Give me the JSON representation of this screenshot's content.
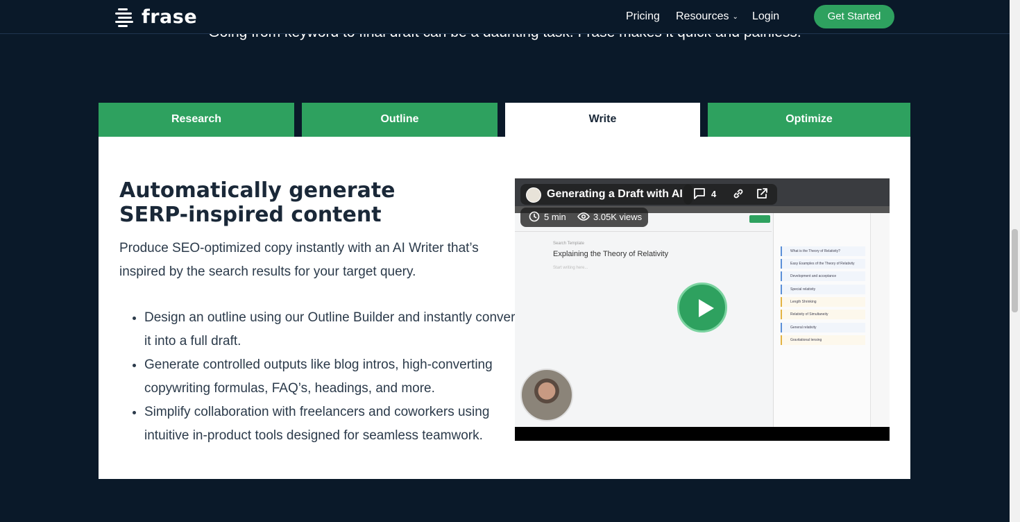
{
  "nav": {
    "brand": "frase",
    "links": [
      "Pricing",
      "Resources",
      "Login"
    ],
    "cta": "Get Started"
  },
  "hero": {
    "subtitle": "Going from keyword to final draft can be a daunting task. Frase makes it quick and painless."
  },
  "tabs": [
    {
      "label": "Research",
      "active": false
    },
    {
      "label": "Outline",
      "active": false
    },
    {
      "label": "Write",
      "active": true
    },
    {
      "label": "Optimize",
      "active": false
    }
  ],
  "panel": {
    "heading": "Automatically generate SERP-inspired content",
    "intro": "Produce SEO-optimized copy instantly with an AI Writer that’s inspired by the search results for your target query.",
    "bullets": [
      "Design an outline using our Outline Builder and instantly convert it into a full draft.",
      "Generate controlled outputs like blog intros, high-converting copywriting formulas, FAQ’s, headings, and more.",
      "Simplify collaboration with freelancers and coworkers using intuitive in-product tools designed for seamless teamwork."
    ]
  },
  "video": {
    "title": "Generating a Draft with AI",
    "comment_count": "4",
    "duration": "5 min",
    "views": "3.05K views",
    "doc_label": "Search Template",
    "doc_title": "Explaining the Theory of Relativity",
    "doc_placeholder": "Start writing here...",
    "outline_items": [
      "What is the Theory of Relativity?",
      "Easy Examples of the Theory of Relativity",
      "Development and acceptance",
      "Special relativity",
      "Length Shrinking",
      "Relativity of Simultaneity",
      "General relativity",
      "Gravitational lensing"
    ]
  },
  "colors": {
    "accent": "#2ea15f",
    "page_bg": "#0a1929",
    "text": "#2b3a4a"
  }
}
